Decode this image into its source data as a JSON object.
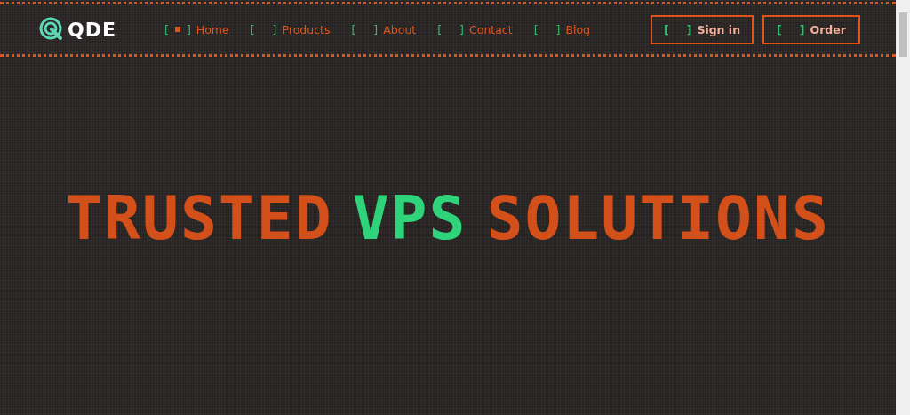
{
  "logo": {
    "text": "QDE"
  },
  "nav": [
    {
      "open": "[",
      "close": "]",
      "label": "Home",
      "selected": true
    },
    {
      "open": "[",
      "close": "]",
      "label": "Products",
      "selected": false
    },
    {
      "open": "[",
      "close": "]",
      "label": "About",
      "selected": false
    },
    {
      "open": "[",
      "close": "]",
      "label": "Contact",
      "selected": false
    },
    {
      "open": "[",
      "close": "]",
      "label": "Blog",
      "selected": false
    }
  ],
  "actions": [
    {
      "open": "[",
      "close": "]",
      "label": "Sign in"
    },
    {
      "open": "[",
      "close": "]",
      "label": "Order"
    }
  ],
  "headline": [
    {
      "text": "TRUSTED",
      "kind": "plain"
    },
    {
      "text": "VPS",
      "kind": "accent"
    },
    {
      "text": "SOLUTIONS",
      "kind": "plain"
    }
  ]
}
